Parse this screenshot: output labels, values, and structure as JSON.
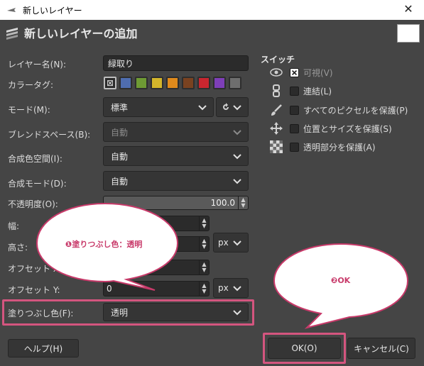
{
  "window": {
    "title": "新しいレイヤー",
    "close_glyph": "✕"
  },
  "header": {
    "title": "新しいレイヤーの追加"
  },
  "form": {
    "layer_name": {
      "label": "レイヤー名(N):",
      "value": "緑取り"
    },
    "color_tag": {
      "label": "カラータグ:",
      "none_glyph": "⊠",
      "colors": [
        "#4f6db0",
        "#6e9a34",
        "#d3b52b",
        "#e08a1c",
        "#7a4220",
        "#c9262f",
        "#7e3fb8",
        "#6e6e6e"
      ]
    },
    "mode": {
      "label": "モード(M):",
      "value": "標準"
    },
    "blend_space": {
      "label": "ブレンドスペース(B):",
      "value": "自動"
    },
    "composite_space": {
      "label": "合成色空間(I):",
      "value": "自動"
    },
    "composite_mode": {
      "label": "合成モード(D):",
      "value": "自動"
    },
    "opacity": {
      "label": "不透明度(O):",
      "value": "100.0"
    },
    "width": {
      "label": "幅:"
    },
    "height": {
      "label": "高さ:",
      "unit": "px"
    },
    "offset_x": {
      "label": "オフセット X:"
    },
    "offset_y": {
      "label": "オフセット Y:",
      "value": "0",
      "unit": "px"
    },
    "fill": {
      "label": "塗りつぶし色(F):",
      "value": "透明"
    }
  },
  "switches": {
    "title": "スイッチ",
    "items": [
      {
        "label": "可視(V)",
        "checked": true,
        "icon": "eye-icon"
      },
      {
        "label": "連結(L)",
        "checked": false,
        "icon": "chain-icon"
      },
      {
        "label": "すべてのピクセルを保護(P)",
        "checked": false,
        "icon": "brush-icon"
      },
      {
        "label": "位置とサイズを保護(S)",
        "checked": false,
        "icon": "move-icon"
      },
      {
        "label": "透明部分を保護(A)",
        "checked": false,
        "icon": "checker-icon"
      }
    ]
  },
  "buttons": {
    "help": "ヘルプ(H)",
    "ok": "OK(O)",
    "cancel": "キャンセル(C)"
  },
  "callouts": {
    "fill_note": "❶塗りつぶし色：透明",
    "ok_note": "❷OK"
  },
  "colors": {
    "highlight": "#d4557f",
    "callout_text": "#c83a6a"
  }
}
